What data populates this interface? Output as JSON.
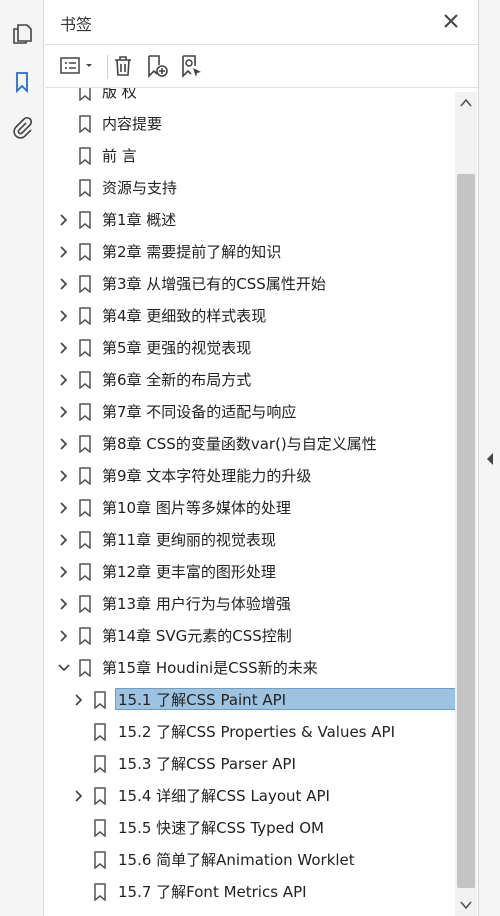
{
  "panel": {
    "title": "书签"
  },
  "rail": {
    "icons": [
      "pages-icon",
      "bookmarks-icon",
      "attachments-icon"
    ]
  },
  "toolbar": {
    "icons": [
      "options-menu-icon",
      "delete-icon",
      "new-bookmark-icon",
      "new-bookmark-from-structure-icon"
    ]
  },
  "colors": {
    "selected_bg": "#9dc3e0",
    "accent": "#1f6fd0",
    "scroll_thumb": "#c4c4c4"
  },
  "bookmarks": [
    {
      "label": "版  权",
      "level": 1,
      "expander": "none"
    },
    {
      "label": "内容提要",
      "level": 1,
      "expander": "none"
    },
    {
      "label": "前  言",
      "level": 1,
      "expander": "none"
    },
    {
      "label": "资源与支持",
      "level": 1,
      "expander": "none"
    },
    {
      "label": "第1章  概述",
      "level": 1,
      "expander": "collapsed"
    },
    {
      "label": "第2章  需要提前了解的知识",
      "level": 1,
      "expander": "collapsed"
    },
    {
      "label": "第3章  从增强已有的CSS属性开始",
      "level": 1,
      "expander": "collapsed"
    },
    {
      "label": "第4章  更细致的样式表现",
      "level": 1,
      "expander": "collapsed"
    },
    {
      "label": "第5章  更强的视觉表现",
      "level": 1,
      "expander": "collapsed"
    },
    {
      "label": "第6章  全新的布局方式",
      "level": 1,
      "expander": "collapsed"
    },
    {
      "label": "第7章  不同设备的适配与响应",
      "level": 1,
      "expander": "collapsed"
    },
    {
      "label": "第8章  CSS的变量函数var()与自定义属性",
      "level": 1,
      "expander": "collapsed"
    },
    {
      "label": "第9章  文本字符处理能力的升级",
      "level": 1,
      "expander": "collapsed"
    },
    {
      "label": "第10章  图片等多媒体的处理",
      "level": 1,
      "expander": "collapsed"
    },
    {
      "label": "第11章  更绚丽的视觉表现",
      "level": 1,
      "expander": "collapsed"
    },
    {
      "label": "第12章  更丰富的图形处理",
      "level": 1,
      "expander": "collapsed"
    },
    {
      "label": "第13章  用户行为与体验增强",
      "level": 1,
      "expander": "collapsed"
    },
    {
      "label": "第14章  SVG元素的CSS控制",
      "level": 1,
      "expander": "collapsed"
    },
    {
      "label": "第15章  Houdini是CSS新的未来",
      "level": 1,
      "expander": "expanded"
    },
    {
      "label": "15.1  了解CSS Paint API",
      "level": 2,
      "expander": "collapsed",
      "selected": true
    },
    {
      "label": "15.2  了解CSS Properties & Values API",
      "level": 2,
      "expander": "none"
    },
    {
      "label": "15.3  了解CSS Parser API",
      "level": 2,
      "expander": "none"
    },
    {
      "label": "15.4  详细了解CSS Layout API",
      "level": 2,
      "expander": "collapsed"
    },
    {
      "label": "15.5  快速了解CSS Typed OM",
      "level": 2,
      "expander": "none"
    },
    {
      "label": "15.6  简单了解Animation Worklet",
      "level": 2,
      "expander": "none"
    },
    {
      "label": "15.7  了解Font Metrics API",
      "level": 2,
      "expander": "none"
    }
  ]
}
